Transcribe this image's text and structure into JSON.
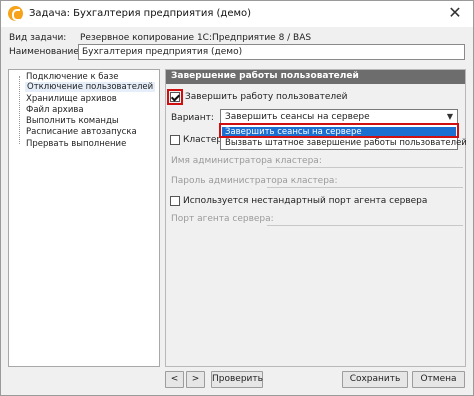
{
  "window": {
    "title": "Задача: Бухгалтерия предприятия (демо)",
    "close_glyph": "✕"
  },
  "task": {
    "type_label": "Вид задачи:",
    "type_value": "Резервное копирование 1С:Предприятие 8 / BAS",
    "name_label": "Наименование:",
    "name_value": "Бухгалтерия предприятия (демо)"
  },
  "sidebar": {
    "items": [
      {
        "label": "Подключение к базе"
      },
      {
        "label": "Отключение пользователей"
      },
      {
        "label": "Хранилище архивов"
      },
      {
        "label": "Файл архива"
      },
      {
        "label": "Выполнить команды"
      },
      {
        "label": "Расписание автозапуска"
      },
      {
        "label": "Прервать выполнение"
      }
    ],
    "selected_index": 1
  },
  "panel": {
    "header": "Завершение работы пользователей",
    "terminate_label": "Завершить работу пользователей",
    "terminate_checked": true,
    "variant_label": "Вариант:",
    "variant_value": "Завершить сеансы на сервере",
    "variant_options": [
      "Завершить сеансы на сервере",
      "Вызвать штатное завершение работы пользователей"
    ],
    "cluster_label": "Кластер тре",
    "cluster_admin_name_label": "Имя администратора кластера:",
    "cluster_admin_password_label": "Пароль администратора кластера:",
    "nonstandard_port_label": "Используется нестандартный порт агента сервера",
    "agent_port_label": "Порт агента сервера:"
  },
  "footer": {
    "prev_label": "<",
    "next_label": ">",
    "check_label": "Проверить",
    "save_label": "Сохранить",
    "cancel_label": "Отмена"
  },
  "colors": {
    "accent_selection": "#1a6fd0",
    "highlight_outline": "#d01010",
    "header_bar": "#6d6d6d",
    "app_icon": "#f6a21a"
  }
}
